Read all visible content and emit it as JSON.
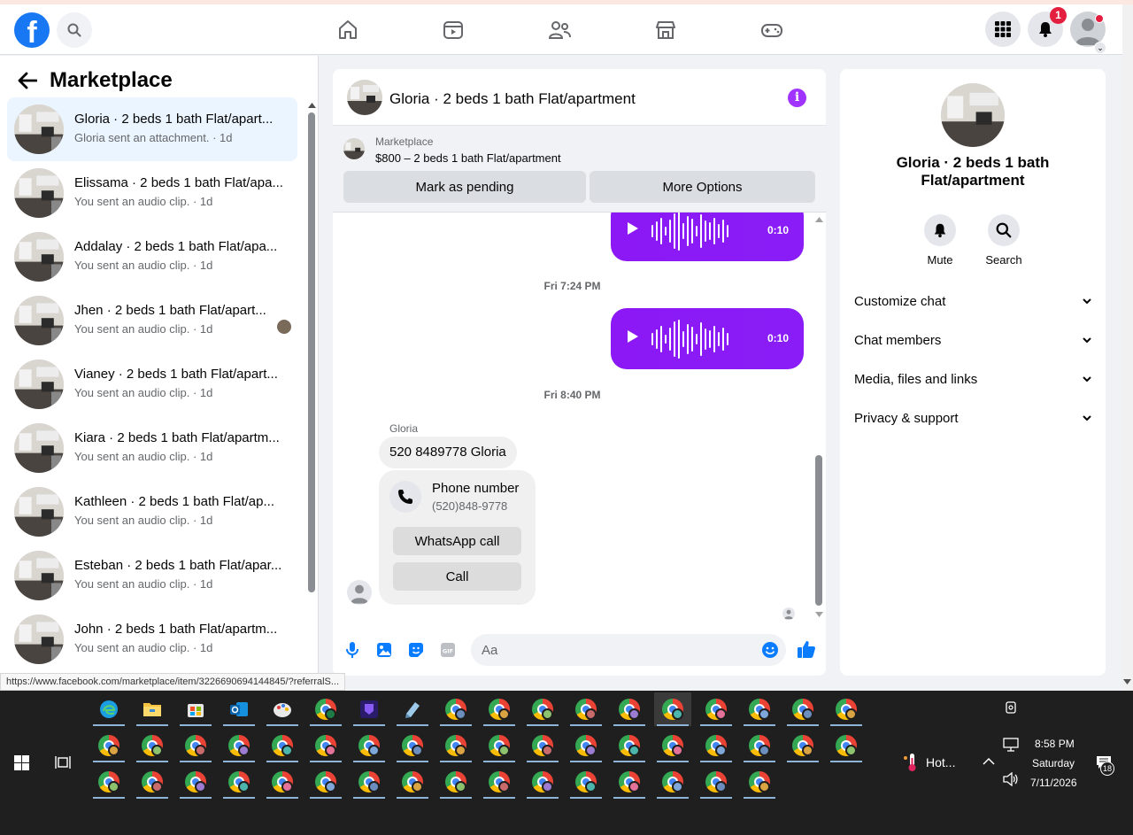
{
  "topbar": {
    "logo": "f",
    "notif_count": "1",
    "nav_icons": [
      "home-icon",
      "watch-icon",
      "friends-icon",
      "marketplace-icon",
      "gaming-icon"
    ]
  },
  "sidebar": {
    "title": "Marketplace",
    "conversations": [
      {
        "name": "Gloria · 2 beds 1 bath Flat/apart...",
        "sub": "Gloria sent an attachment. · 1d"
      },
      {
        "name": "Elissama · 2 beds 1 bath Flat/apa...",
        "sub": "You sent an audio clip. · 1d"
      },
      {
        "name": "Addalay · 2 beds 1 bath Flat/apa...",
        "sub": "You sent an audio clip. · 1d"
      },
      {
        "name": "Jhen · 2 beds 1 bath Flat/apart...",
        "sub": "You sent an audio clip. · 1d"
      },
      {
        "name": "Vianey · 2 beds 1 bath Flat/apart...",
        "sub": "You sent an audio clip. · 1d"
      },
      {
        "name": "Kiara · 2 beds 1 bath Flat/apartm...",
        "sub": "You sent an audio clip. · 1d"
      },
      {
        "name": "Kathleen · 2 beds 1 bath Flat/ap...",
        "sub": "You sent an audio clip. · 1d"
      },
      {
        "name": "Esteban · 2 beds 1 bath Flat/apar...",
        "sub": "You sent an audio clip. · 1d"
      },
      {
        "name": "John · 2 beds 1 bath Flat/apartm...",
        "sub": "You sent an audio clip. · 1d"
      }
    ]
  },
  "chat": {
    "title": "Gloria · 2 beds 1 bath Flat/apartment",
    "listing": {
      "label": "Marketplace",
      "price_title": "$800 – 2 beds 1 bath Flat/apartment",
      "mark_pending": "Mark as pending",
      "more_options": "More Options"
    },
    "audio_1_duration": "0:10",
    "timestamp_1": "Fri 7:24 PM",
    "audio_2_duration": "0:10",
    "timestamp_2": "Fri 8:40 PM",
    "sender": "Gloria",
    "text_message": "520 8489778 Gloria",
    "phone_card": {
      "title": "Phone number",
      "number": "(520)848-9778",
      "whatsapp": "WhatsApp call",
      "call": "Call"
    },
    "composer_placeholder": "Aa"
  },
  "info_panel": {
    "title": "Gloria · 2 beds 1 bath Flat/apartment",
    "mute": "Mute",
    "search": "Search",
    "sections": [
      "Customize chat",
      "Chat members",
      "Media, files and links",
      "Privacy & support"
    ]
  },
  "status_url": "https://www.facebook.com/marketplace/item/3226690694144845/?referralS...",
  "taskbar": {
    "weather": "Hot...",
    "time": "8:58 PM",
    "day": "Saturday",
    "date": "7/11/2026",
    "notif_count": "18"
  }
}
